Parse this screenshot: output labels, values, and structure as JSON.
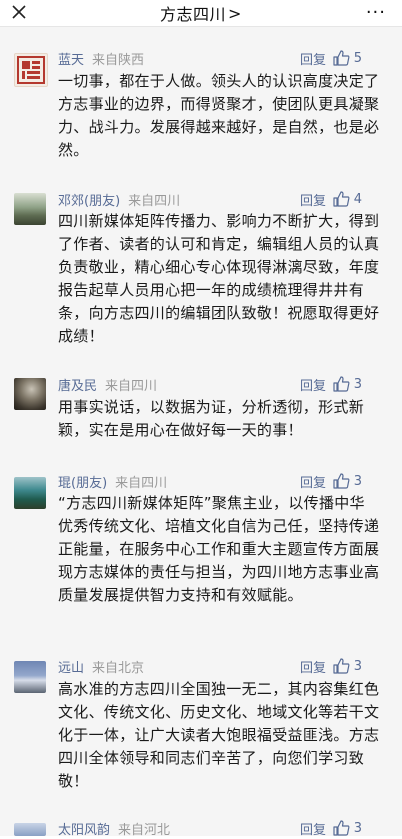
{
  "header": {
    "title": "方志四川",
    "arrow": ">",
    "more": "···"
  },
  "comments": [
    {
      "name": "蓝天",
      "from": "来自陕西",
      "reply": "回复",
      "likes": "5",
      "text": "一切事，都在于人做。领头人的认识高度决定了方志事业的边界，而得贤聚才，使团队更具凝聚力、战斗力。发展得越来越好，是自然，也是必然。"
    },
    {
      "name": "邓郊(朋友)",
      "from": "来自四川",
      "reply": "回复",
      "likes": "4",
      "text": "四川新媒体矩阵传播力、影响力不断扩大，得到了作者、读者的认可和肯定，编辑组人员的认真负责敬业，精心细心专心体现得淋漓尽致，年度报告起草人员用心把一年的成绩梳理得井井有条，向方志四川的编辑团队致敬！祝愿取得更好成绩！"
    },
    {
      "name": "唐及民",
      "from": "来自四川",
      "reply": "回复",
      "likes": "3",
      "text": "用事实说话，以数据为证，分析透彻，形式新颖，实在是用心在做好每一天的事！"
    },
    {
      "name": "琨(朋友)",
      "from": "来自四川",
      "reply": "回复",
      "likes": "3",
      "text": "“方志四川新媒体矩阵”聚焦主业，以传播中华优秀传统文化、培植文化自信为己任，坚持传递正能量，在服务中心工作和重大主题宣传方面展现方志媒体的责任与担当，为四川地方志事业高质量发展提供智力支持和有效赋能。"
    },
    {
      "name": "远山",
      "from": "来自北京",
      "reply": "回复",
      "likes": "3",
      "text": "高水准的方志四川全国独一无二，其内容集红色文化、传统文化、历史文化、地域文化等若干文化于一体，让广大读者大饱眼福受益匪浅。方志四川全体领导和同志们辛苦了，向您们学习致敬！"
    },
    {
      "name": "太阳风韵",
      "from": "来自河北",
      "reply": "回复",
      "likes": "3",
      "text": ""
    }
  ]
}
